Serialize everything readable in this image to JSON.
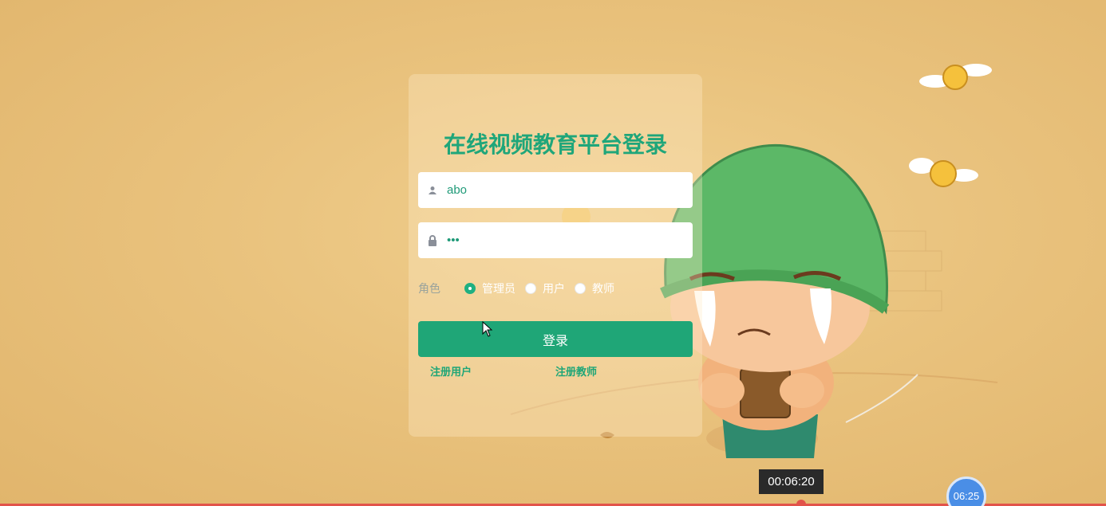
{
  "login": {
    "title": "在线视频教育平台登录",
    "username_value": "abo",
    "password_value": "•••",
    "role_label": "角色",
    "roles": [
      "管理员",
      "用户",
      "教师"
    ],
    "selected_role": "管理员",
    "submit_label": "登录",
    "register_user_label": "注册用户",
    "register_teacher_label": "注册教师"
  },
  "player": {
    "timestamp": "00:06:20",
    "clock": "06:25"
  },
  "colors": {
    "accent": "#1fa677",
    "title": "#1fa67a",
    "background": "#e9c27d"
  },
  "icons": [
    "user-icon",
    "lock-icon",
    "mouse-cursor-icon"
  ]
}
